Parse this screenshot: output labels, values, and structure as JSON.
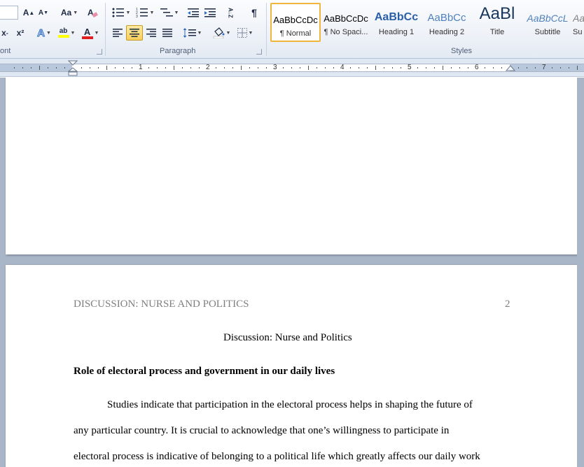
{
  "ribbon": {
    "font_group": {
      "label": "ont",
      "grow_label": "A",
      "shrink_label": "A",
      "case_label": "Aa",
      "subscript_label": "x",
      "superscript_label": "x²",
      "text_effects_label": "A",
      "highlight_label": "ab",
      "font_color_label": "A"
    },
    "paragraph_group": {
      "label": "Paragraph",
      "show_marks_label": "¶",
      "sort_label": "A↓Z"
    },
    "styles_group": {
      "label": "Styles",
      "styles": [
        {
          "sample": "AaBbCcDc",
          "name": "¶ Normal",
          "active": true
        },
        {
          "sample": "AaBbCcDc",
          "name": "¶ No Spaci..."
        },
        {
          "sample": "AaBbCc",
          "name": "Heading 1"
        },
        {
          "sample": "AaBbCc",
          "name": "Heading 2"
        },
        {
          "sample": "AaBl",
          "name": "Title"
        },
        {
          "sample": "AaBbCcL",
          "name": "Subtitle"
        },
        {
          "sample": "AaBbCcL",
          "name": "Su"
        }
      ]
    }
  },
  "ruler": {
    "numbers": [
      "1",
      "2",
      "3",
      "4",
      "5",
      "6",
      "7"
    ]
  },
  "document": {
    "running_head": "DISCUSSION: NURSE AND POLITICS",
    "page_number": "2",
    "title": "Discussion:  Nurse and Politics",
    "heading": "Role of electoral process and government in our daily lives",
    "lines": [
      "Studies indicate that participation in the electoral process helps in shaping the future of",
      "any particular country. It is crucial to acknowledge that one’s willingness to participate in",
      "electoral process is indicative of belonging to a political life which greatly affects our daily work"
    ]
  },
  "colors": {
    "ribbon_bg": "#eef2f8",
    "doc_bg": "#a9b6c8",
    "active_style": "#f0b53c"
  }
}
